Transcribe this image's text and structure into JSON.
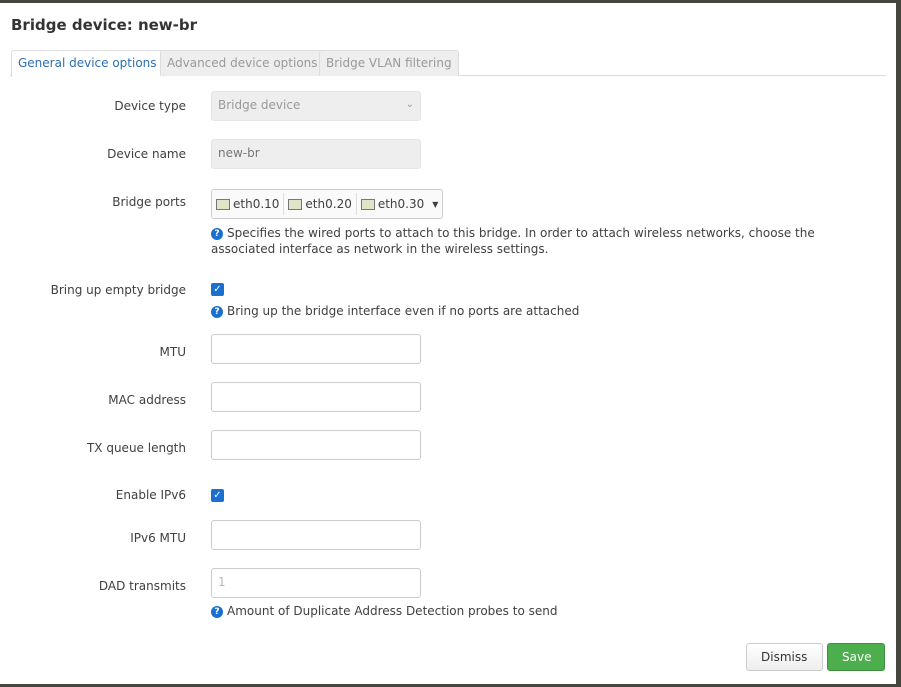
{
  "title": "Bridge device: new-br",
  "tabs": [
    "General device options",
    "Advanced device options",
    "Bridge VLAN filtering"
  ],
  "fields": {
    "device_type": {
      "label": "Device type",
      "value": "Bridge device"
    },
    "device_name": {
      "label": "Device name",
      "value": "new-br"
    },
    "bridge_ports": {
      "label": "Bridge ports",
      "ports": [
        "eth0.10",
        "eth0.20",
        "eth0.30"
      ],
      "help": "Specifies the wired ports to attach to this bridge. In order to attach wireless networks, choose the associated interface as network in the wireless settings."
    },
    "bring_up_empty": {
      "label": "Bring up empty bridge",
      "checked": true,
      "help": "Bring up the bridge interface even if no ports are attached"
    },
    "mtu": {
      "label": "MTU",
      "value": ""
    },
    "mac": {
      "label": "MAC address",
      "value": ""
    },
    "txqueue": {
      "label": "TX queue length",
      "value": ""
    },
    "ipv6": {
      "label": "Enable IPv6",
      "checked": true
    },
    "ipv6_mtu": {
      "label": "IPv6 MTU",
      "value": ""
    },
    "dad": {
      "label": "DAD transmits",
      "placeholder": "1",
      "help": "Amount of Duplicate Address Detection probes to send"
    }
  },
  "buttons": {
    "dismiss": "Dismiss",
    "save": "Save"
  },
  "colors": {
    "accent": "#1a6fd0",
    "save": "#4cae4c"
  }
}
